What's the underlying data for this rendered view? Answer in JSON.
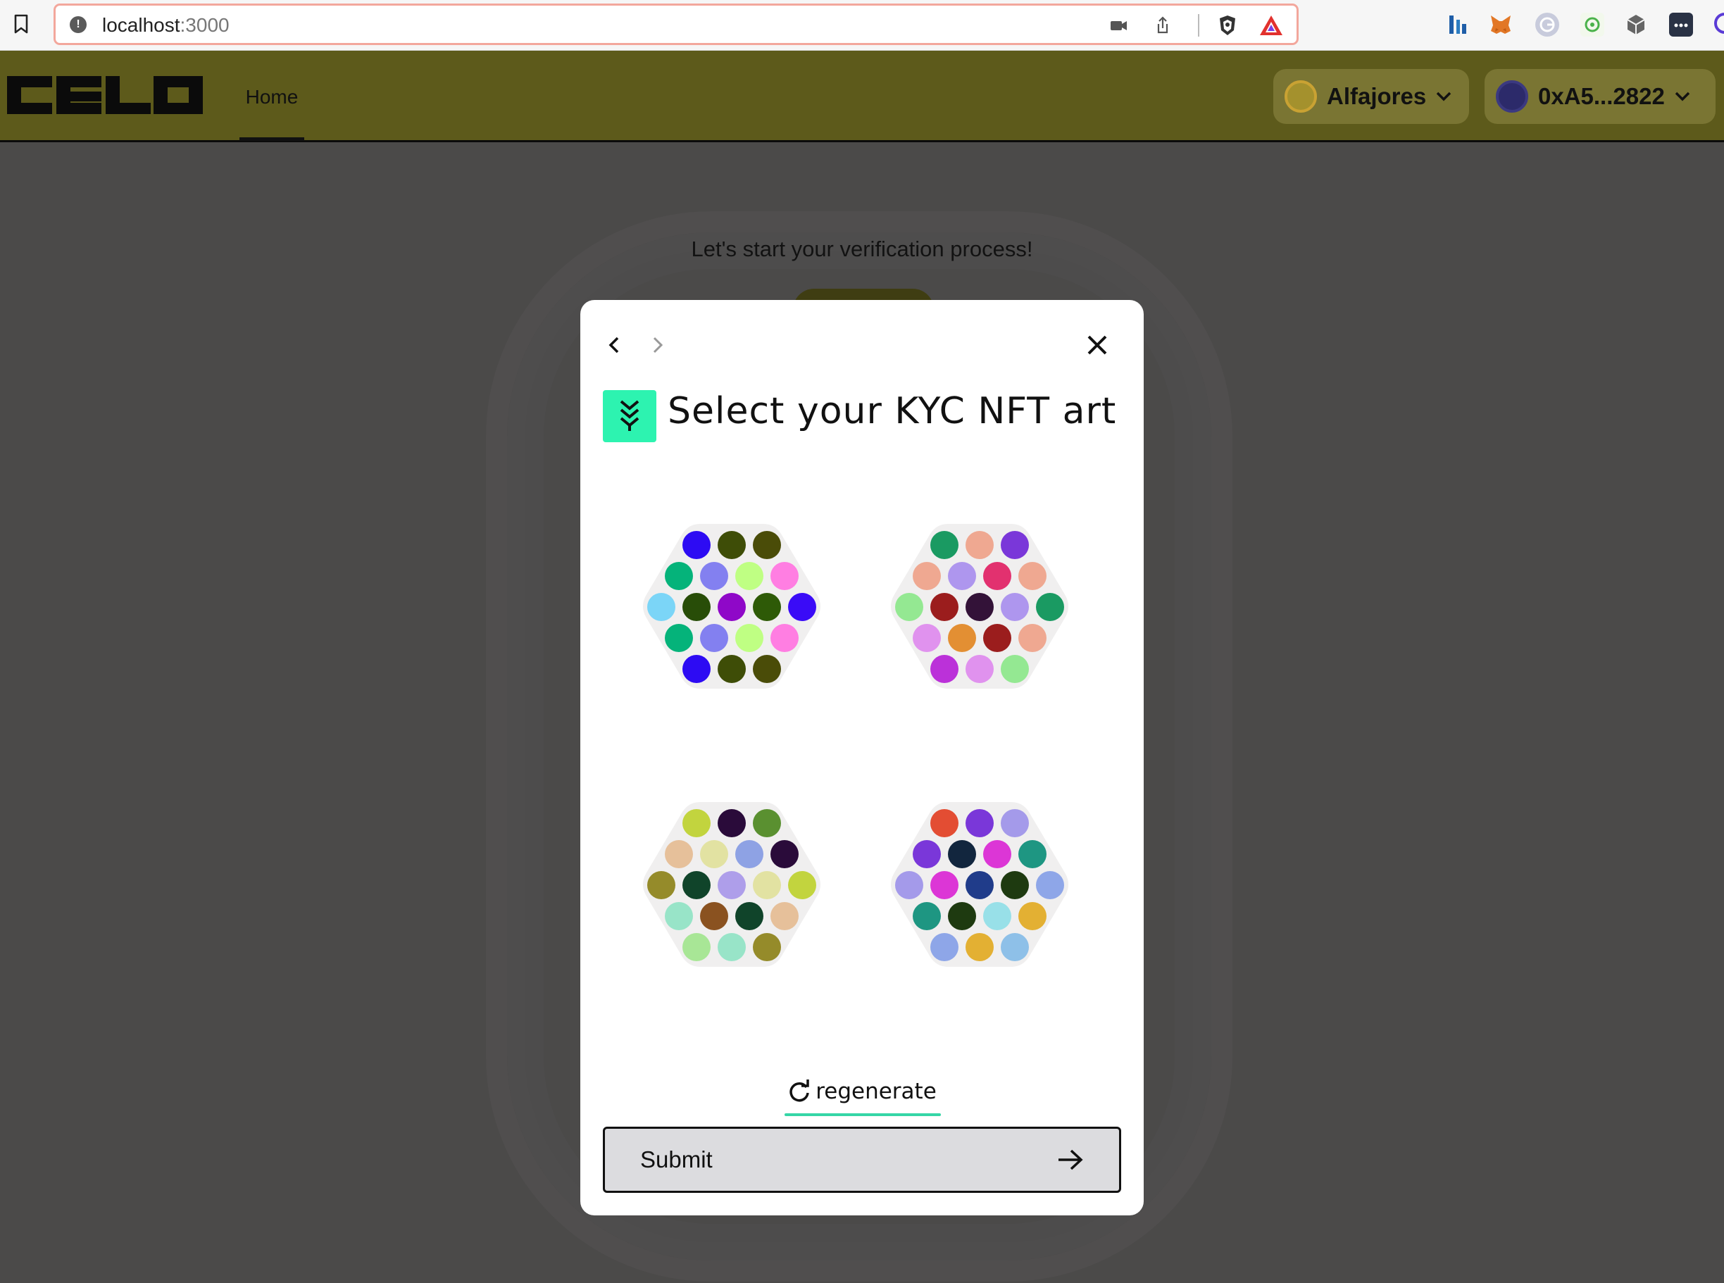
{
  "browser": {
    "url_host": "localhost",
    "url_port": ":3000",
    "icons": [
      "bookmark-icon",
      "site-info-icon",
      "camera-icon",
      "share-icon",
      "brave-shields-icon",
      "brave-rewards-icon"
    ],
    "extensions": [
      "tradingview-icon",
      "metamask-icon",
      "grammarly-icon",
      "gas-extension-icon",
      "cube-extension-icon",
      "password-manager-icon"
    ]
  },
  "header": {
    "logo": "celo",
    "nav_home": "Home",
    "network": "Alfajores",
    "account": "0xA5...2822",
    "colors": {
      "bar": "#5d5a1b",
      "pill": "#7a7533"
    }
  },
  "page": {
    "prompt": "Let's start your verification process!"
  },
  "modal": {
    "title": "Select your KYC NFT art",
    "regenerate": "regenerate",
    "submit": "Submit",
    "accent": "#2df3b0",
    "arts": [
      {
        "colors": [
          "#2d0bf3",
          "#3e4d07",
          "#4a4c08",
          "#05b37a",
          "#8380f0",
          "#bfff83",
          "#ff7ee2",
          "#7bd5f7",
          "#284d08",
          "#8f08c8",
          "#2e5a07",
          "#3a0bf7",
          "#05b37a",
          "#8380f0",
          "#bfff83",
          "#ff7ee2",
          "#2d0bf3",
          "#3e4d07",
          "#4a4c08"
        ]
      },
      {
        "colors": [
          "#1a9a62",
          "#efa891",
          "#7a37d9",
          "#efa891",
          "#ae96ee",
          "#e2316f",
          "#efa891",
          "#94e892",
          "#9b1d1d",
          "#331238",
          "#ae96ee",
          "#1a9a62",
          "#e092ee",
          "#e38f33",
          "#9b1d1d",
          "#efa891",
          "#bb31d9",
          "#e092ee",
          "#94e892"
        ]
      },
      {
        "colors": [
          "#c2d43e",
          "#2a0b3a",
          "#5a9030",
          "#e6c09a",
          "#e2e2a2",
          "#8ea2e4",
          "#2a0b3a",
          "#958b2a",
          "#10442a",
          "#ae9eea",
          "#e2e2a2",
          "#c2d43e",
          "#98e4c8",
          "#8a5220",
          "#10442a",
          "#e6c09a",
          "#a8e696",
          "#98e4c8",
          "#958b2a"
        ]
      },
      {
        "colors": [
          "#e34d33",
          "#7a37d9",
          "#a49aea",
          "#7a37d9",
          "#12263e",
          "#dc36d6",
          "#1e9682",
          "#a49aea",
          "#dc36d6",
          "#203c8a",
          "#1e3a10",
          "#8ea6e8",
          "#1e9682",
          "#1e3a10",
          "#98e0e8",
          "#e3b033",
          "#8ea6e8",
          "#e3b033",
          "#8ec0e8"
        ]
      }
    ]
  }
}
